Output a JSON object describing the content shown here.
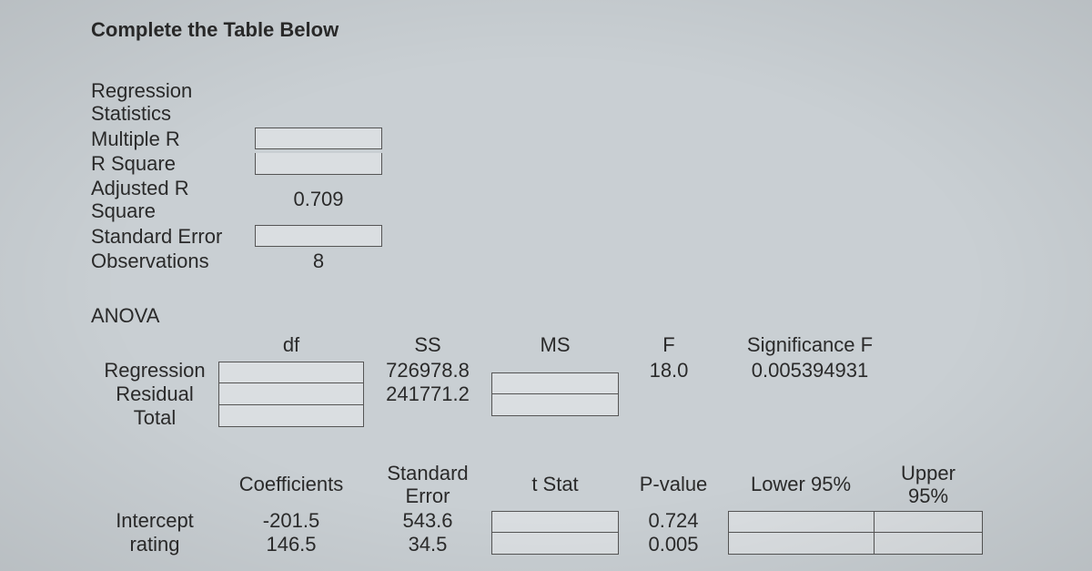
{
  "title": "Complete the Table Below",
  "regstats": {
    "heading1": "Regression",
    "heading2": "Statistics",
    "multiple_r_label": "Multiple R",
    "r_square_label": "R Square",
    "adj_r_square_label": "Adjusted R Square",
    "adj_r_square_value": "0.709",
    "std_error_label": "Standard Error",
    "observations_label": "Observations",
    "observations_value": "8"
  },
  "anova": {
    "title": "ANOVA",
    "headers": {
      "df": "df",
      "ss": "SS",
      "ms": "MS",
      "f": "F",
      "sigf": "Significance F"
    },
    "rows": {
      "regression_label": "Regression",
      "regression_ss": "726978.8",
      "regression_f": "18.0",
      "regression_sigf": "0.005394931",
      "residual_label": "Residual",
      "residual_ss": "241771.2",
      "total_label": "Total"
    }
  },
  "coef": {
    "headers": {
      "coefficients": "Coefficients",
      "stderr1": "Standard",
      "stderr2": "Error",
      "tstat": "t Stat",
      "pvalue": "P-value",
      "lower95": "Lower 95%",
      "upper95_1": "Upper",
      "upper95_2": "95%"
    },
    "intercept": {
      "label": "Intercept",
      "coefficient": "-201.5",
      "stderr": "543.6",
      "pvalue": "0.724"
    },
    "rating": {
      "label": "rating",
      "coefficient": "146.5",
      "stderr": "34.5",
      "pvalue": "0.005"
    }
  }
}
